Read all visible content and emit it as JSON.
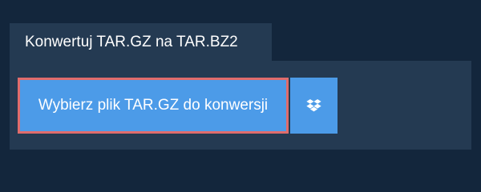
{
  "tab": {
    "title": "Konwertuj TAR.GZ na TAR.BZ2"
  },
  "actions": {
    "choose_file_label": "Wybierz plik TAR.GZ do konwersji",
    "dropbox_icon": "dropbox-icon"
  },
  "colors": {
    "background": "#13263c",
    "panel": "#243a52",
    "button": "#4c9be8",
    "highlight_border": "#e06c6c"
  }
}
